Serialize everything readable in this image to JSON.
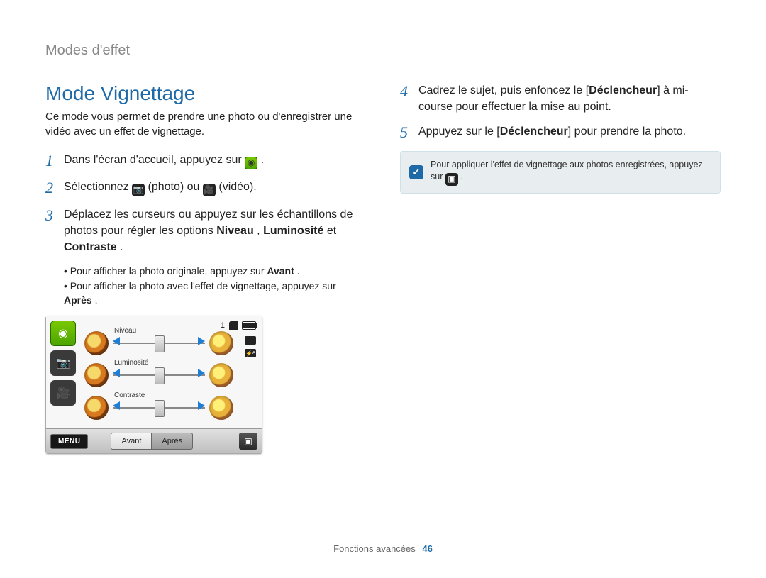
{
  "header": {
    "section": "Modes d'effet"
  },
  "title": "Mode Vignettage",
  "intro": "Ce mode vous permet de prendre une photo ou d'enregistrer une vidéo avec un effet de vignettage.",
  "steps": {
    "s1": {
      "num": "1",
      "pre": "Dans l'écran d'accueil, appuyez sur ",
      "post": "."
    },
    "s2": {
      "num": "2",
      "pre": "Sélectionnez ",
      "mid1": " (photo) ou ",
      "mid2": " (vidéo).",
      "post": ""
    },
    "s3": {
      "num": "3",
      "line": "Déplacez les curseurs ou appuyez sur les échantillons de photos pour régler les options ",
      "b1": "Niveau",
      "sep1": ", ",
      "b2": "Luminosité",
      "sep2": " et ",
      "b3": "Contraste",
      "end": "."
    },
    "s4": {
      "num": "4",
      "pre": "Cadrez le sujet, puis enfoncez le [",
      "bold": "Déclencheur",
      "post": "] à mi-course pour effectuer la mise au point."
    },
    "s5": {
      "num": "5",
      "pre": "Appuyez sur le [",
      "bold": "Déclencheur",
      "post": "] pour prendre la photo."
    }
  },
  "sub": {
    "a_pre": "Pour afficher la photo originale, appuyez sur ",
    "a_bold": "Avant",
    "a_post": ".",
    "b_pre": "Pour afficher la photo avec l'effet de vignettage, appuyez sur ",
    "b_bold": "Après",
    "b_post": "."
  },
  "device": {
    "counter": "1",
    "sliders": [
      "Niveau",
      "Luminosité",
      "Contraste"
    ],
    "menu": "MENU",
    "tab_before": "Avant",
    "tab_after": "Après"
  },
  "note": {
    "text_pre": "Pour appliquer l'effet de vignettage aux photos enregistrées, appuyez sur ",
    "text_post": "."
  },
  "footer": {
    "label": "Fonctions avancées",
    "page": "46"
  }
}
